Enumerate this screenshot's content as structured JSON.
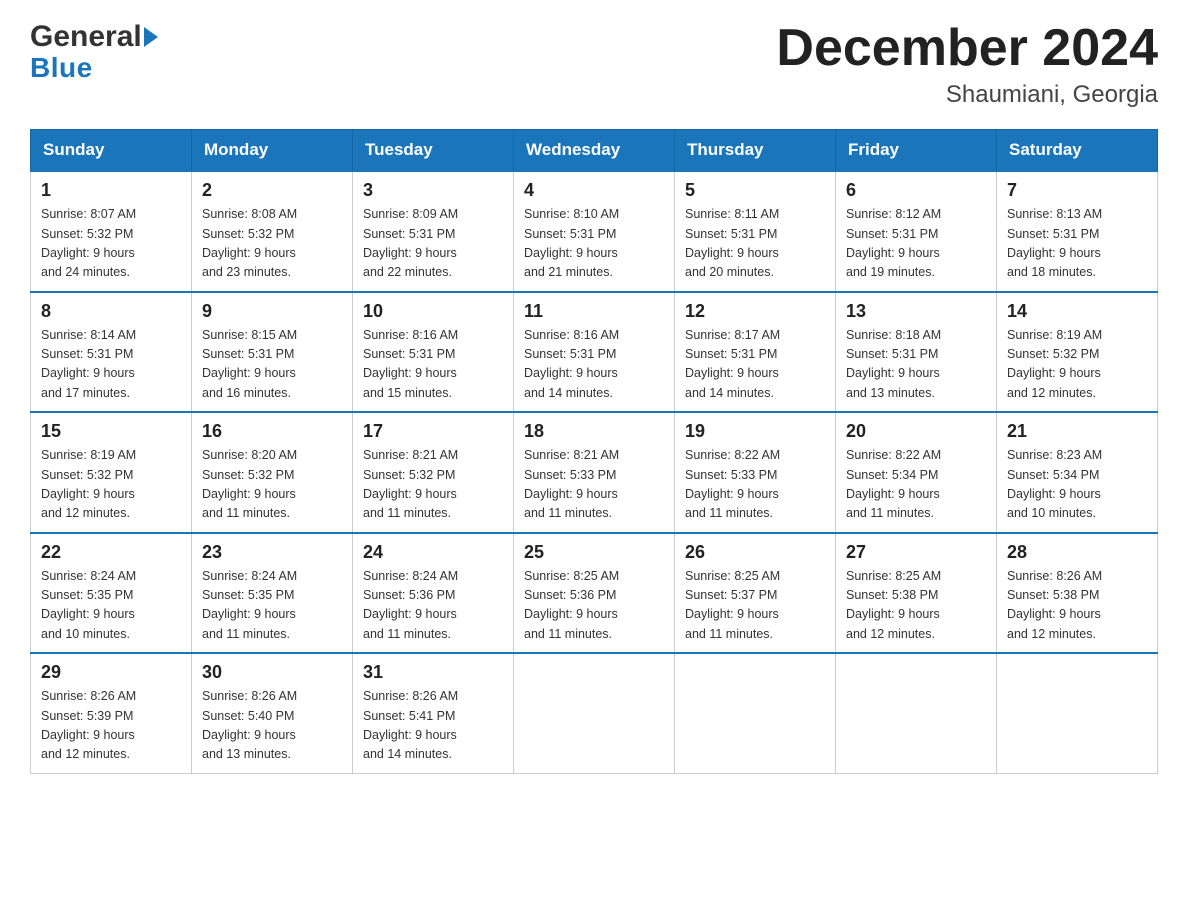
{
  "header": {
    "title": "December 2024",
    "location": "Shaumiani, Georgia",
    "logo_general": "General",
    "logo_blue": "Blue"
  },
  "days_of_week": [
    "Sunday",
    "Monday",
    "Tuesday",
    "Wednesday",
    "Thursday",
    "Friday",
    "Saturday"
  ],
  "weeks": [
    [
      {
        "day": "1",
        "sunrise": "8:07 AM",
        "sunset": "5:32 PM",
        "daylight": "9 hours and 24 minutes."
      },
      {
        "day": "2",
        "sunrise": "8:08 AM",
        "sunset": "5:32 PM",
        "daylight": "9 hours and 23 minutes."
      },
      {
        "day": "3",
        "sunrise": "8:09 AM",
        "sunset": "5:31 PM",
        "daylight": "9 hours and 22 minutes."
      },
      {
        "day": "4",
        "sunrise": "8:10 AM",
        "sunset": "5:31 PM",
        "daylight": "9 hours and 21 minutes."
      },
      {
        "day": "5",
        "sunrise": "8:11 AM",
        "sunset": "5:31 PM",
        "daylight": "9 hours and 20 minutes."
      },
      {
        "day": "6",
        "sunrise": "8:12 AM",
        "sunset": "5:31 PM",
        "daylight": "9 hours and 19 minutes."
      },
      {
        "day": "7",
        "sunrise": "8:13 AM",
        "sunset": "5:31 PM",
        "daylight": "9 hours and 18 minutes."
      }
    ],
    [
      {
        "day": "8",
        "sunrise": "8:14 AM",
        "sunset": "5:31 PM",
        "daylight": "9 hours and 17 minutes."
      },
      {
        "day": "9",
        "sunrise": "8:15 AM",
        "sunset": "5:31 PM",
        "daylight": "9 hours and 16 minutes."
      },
      {
        "day": "10",
        "sunrise": "8:16 AM",
        "sunset": "5:31 PM",
        "daylight": "9 hours and 15 minutes."
      },
      {
        "day": "11",
        "sunrise": "8:16 AM",
        "sunset": "5:31 PM",
        "daylight": "9 hours and 14 minutes."
      },
      {
        "day": "12",
        "sunrise": "8:17 AM",
        "sunset": "5:31 PM",
        "daylight": "9 hours and 14 minutes."
      },
      {
        "day": "13",
        "sunrise": "8:18 AM",
        "sunset": "5:31 PM",
        "daylight": "9 hours and 13 minutes."
      },
      {
        "day": "14",
        "sunrise": "8:19 AM",
        "sunset": "5:32 PM",
        "daylight": "9 hours and 12 minutes."
      }
    ],
    [
      {
        "day": "15",
        "sunrise": "8:19 AM",
        "sunset": "5:32 PM",
        "daylight": "9 hours and 12 minutes."
      },
      {
        "day": "16",
        "sunrise": "8:20 AM",
        "sunset": "5:32 PM",
        "daylight": "9 hours and 11 minutes."
      },
      {
        "day": "17",
        "sunrise": "8:21 AM",
        "sunset": "5:32 PM",
        "daylight": "9 hours and 11 minutes."
      },
      {
        "day": "18",
        "sunrise": "8:21 AM",
        "sunset": "5:33 PM",
        "daylight": "9 hours and 11 minutes."
      },
      {
        "day": "19",
        "sunrise": "8:22 AM",
        "sunset": "5:33 PM",
        "daylight": "9 hours and 11 minutes."
      },
      {
        "day": "20",
        "sunrise": "8:22 AM",
        "sunset": "5:34 PM",
        "daylight": "9 hours and 11 minutes."
      },
      {
        "day": "21",
        "sunrise": "8:23 AM",
        "sunset": "5:34 PM",
        "daylight": "9 hours and 10 minutes."
      }
    ],
    [
      {
        "day": "22",
        "sunrise": "8:24 AM",
        "sunset": "5:35 PM",
        "daylight": "9 hours and 10 minutes."
      },
      {
        "day": "23",
        "sunrise": "8:24 AM",
        "sunset": "5:35 PM",
        "daylight": "9 hours and 11 minutes."
      },
      {
        "day": "24",
        "sunrise": "8:24 AM",
        "sunset": "5:36 PM",
        "daylight": "9 hours and 11 minutes."
      },
      {
        "day": "25",
        "sunrise": "8:25 AM",
        "sunset": "5:36 PM",
        "daylight": "9 hours and 11 minutes."
      },
      {
        "day": "26",
        "sunrise": "8:25 AM",
        "sunset": "5:37 PM",
        "daylight": "9 hours and 11 minutes."
      },
      {
        "day": "27",
        "sunrise": "8:25 AM",
        "sunset": "5:38 PM",
        "daylight": "9 hours and 12 minutes."
      },
      {
        "day": "28",
        "sunrise": "8:26 AM",
        "sunset": "5:38 PM",
        "daylight": "9 hours and 12 minutes."
      }
    ],
    [
      {
        "day": "29",
        "sunrise": "8:26 AM",
        "sunset": "5:39 PM",
        "daylight": "9 hours and 12 minutes."
      },
      {
        "day": "30",
        "sunrise": "8:26 AM",
        "sunset": "5:40 PM",
        "daylight": "9 hours and 13 minutes."
      },
      {
        "day": "31",
        "sunrise": "8:26 AM",
        "sunset": "5:41 PM",
        "daylight": "9 hours and 14 minutes."
      },
      null,
      null,
      null,
      null
    ]
  ],
  "labels": {
    "sunrise": "Sunrise:",
    "sunset": "Sunset:",
    "daylight": "Daylight:"
  }
}
